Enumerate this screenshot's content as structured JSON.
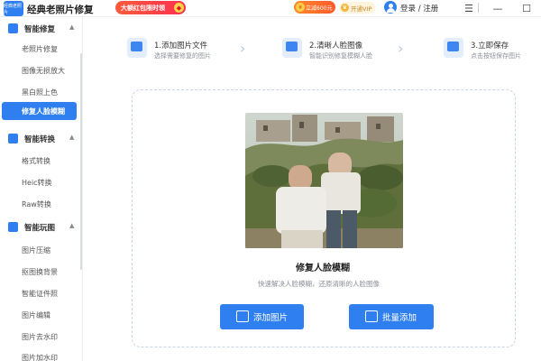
{
  "titlebar": {
    "logo_text": "经典老照片",
    "app_title": "经典老照片修复",
    "promo_label": "大额红包限时领",
    "discount_label": "立减600元",
    "vip_label": "开通VIP",
    "login_label": "登录 / 注册"
  },
  "sidebar": {
    "groups": [
      {
        "label": "智能修复",
        "items": [
          "老照片修复",
          "图像无损放大",
          "黑白照上色",
          "修复人脸模糊"
        ]
      },
      {
        "label": "智能转换",
        "items": [
          "格式转换",
          "Heic转换",
          "Raw转换"
        ]
      },
      {
        "label": "智能玩图",
        "items": [
          "图片压缩",
          "抠图换背景",
          "智能证件照",
          "图片编辑",
          "图片去水印",
          "图片加水印"
        ]
      }
    ],
    "active_item": "修复人脸模糊"
  },
  "steps": [
    {
      "title": "1.添加图片文件",
      "desc": "选择需要修复的图片"
    },
    {
      "title": "2.清晰人脸图像",
      "desc": "智能识别修复模糊人脸"
    },
    {
      "title": "3.立即保存",
      "desc": "点击按钮保存图片"
    }
  ],
  "main": {
    "caption_title": "修复人脸模糊",
    "caption_subtitle": "快速解决人脸模糊，还原清晰的人脸图像",
    "add_button": "添加图片",
    "batch_button": "批量添加"
  },
  "colors": {
    "accent": "#2f7ff0",
    "promo": "#ff3b3b",
    "discount": "#ff6a2a",
    "vip": "#f3b63d"
  }
}
